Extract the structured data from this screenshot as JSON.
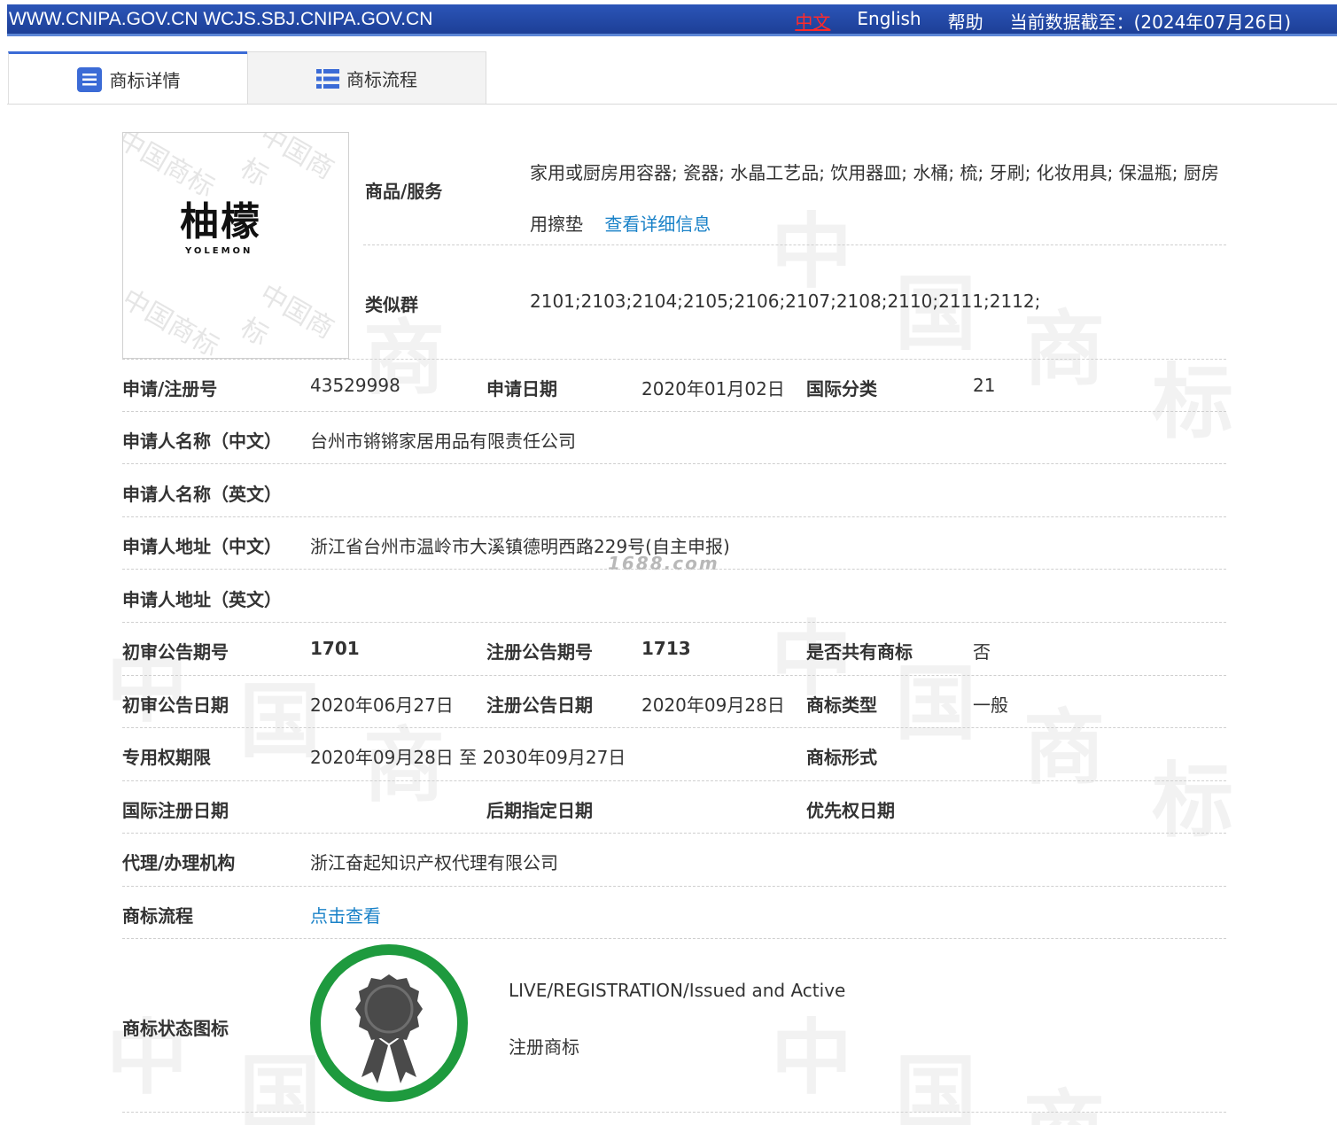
{
  "topbar": {
    "urls": "WWW.CNIPA.GOV.CN WCJS.SBJ.CNIPA.GOV.CN",
    "lang_zh": "中文",
    "lang_en": "English",
    "help": "帮助",
    "data_date": "当前数据截至：(2024年07月26日)"
  },
  "tabs": [
    {
      "label": "商标详情",
      "icon": "list-doc-icon",
      "active": true
    },
    {
      "label": "商标流程",
      "icon": "list-icon",
      "active": false
    }
  ],
  "logo": {
    "mark_cn": "柚檬",
    "mark_en": "YOLEMON",
    "watermark": "中国商标"
  },
  "goods": {
    "label": "商品/服务",
    "value": "家用或厨房用容器; 瓷器; 水晶工艺品; 饮用器皿; 水桶; 梳; 牙刷; 化妆用具; 保温瓶; 厨房用擦垫",
    "link": "查看详细信息"
  },
  "similar_group": {
    "label": "类似群",
    "value": "2101;2103;2104;2105;2106;2107;2108;2110;2111;2112;"
  },
  "fields": {
    "reg_no_label": "申请/注册号",
    "reg_no": "43529998",
    "app_date_label": "申请日期",
    "app_date": "2020年01月02日",
    "intl_class_label": "国际分类",
    "intl_class": "21",
    "applicant_cn_label": "申请人名称（中文）",
    "applicant_cn": "台州市锵锵家居用品有限责任公司",
    "applicant_en_label": "申请人名称（英文）",
    "applicant_en": "",
    "address_cn_label": "申请人地址（中文）",
    "address_cn": "浙江省台州市温岭市大溪镇德明西路229号(自主申报)",
    "address_en_label": "申请人地址（英文）",
    "address_en": "",
    "prelim_no_label": "初审公告期号",
    "prelim_no": "1701",
    "reg_pub_no_label": "注册公告期号",
    "reg_pub_no": "1713",
    "shared_label": "是否共有商标",
    "shared": "否",
    "prelim_date_label": "初审公告日期",
    "prelim_date": "2020年06月27日",
    "reg_pub_date_label": "注册公告日期",
    "reg_pub_date": "2020年09月28日",
    "tm_type_label": "商标类型",
    "tm_type": "一般",
    "term_label": "专用权期限",
    "term": "2020年09月28日 至 2030年09月27日",
    "tm_form_label": "商标形式",
    "tm_form": "",
    "intl_reg_date_label": "国际注册日期",
    "later_date_label": "后期指定日期",
    "priority_date_label": "优先权日期",
    "agency_label": "代理/办理机构",
    "agency": "浙江奋起知识产权代理有限公司",
    "flow_label": "商标流程",
    "flow_link": "点击查看",
    "status_icon_label": "商标状态图标",
    "status_en": "LIVE/REGISTRATION/Issued and Active",
    "status_cn": "注册商标"
  },
  "watermark_text": "1688.com",
  "colors": {
    "topbar": "#2b55b8",
    "link": "#1a82c8",
    "badge_ring": "#1e9a3e",
    "badge_medal": "#4a4a4a"
  }
}
